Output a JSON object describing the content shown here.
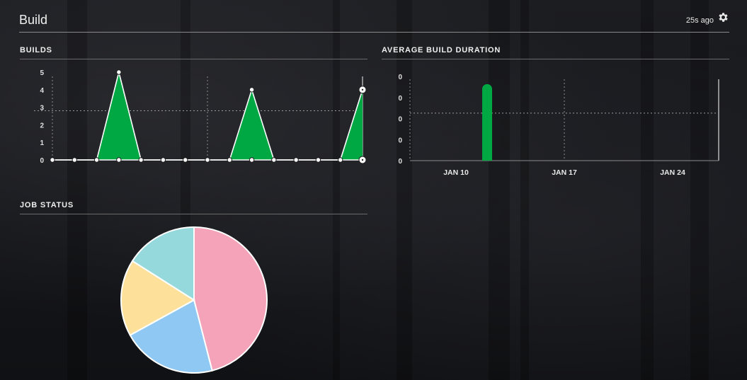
{
  "header": {
    "title": "Build",
    "updated": "25s ago"
  },
  "builds_panel": {
    "title": "BUILDS"
  },
  "duration_panel": {
    "title": "AVERAGE BUILD DURATION"
  },
  "job_status_panel": {
    "title": "JOB STATUS"
  },
  "colors": {
    "success_green": "#00a844",
    "pink": "#f4a3b8",
    "blue": "#8fc8f2",
    "yellow": "#fde09a",
    "teal": "#95d9dc"
  },
  "chart_data": [
    {
      "type": "area",
      "title": "BUILDS",
      "y_ticks": [
        "0",
        "1",
        "2",
        "3",
        "4",
        "5"
      ],
      "ylim": [
        0,
        5
      ],
      "x_index": [
        0,
        1,
        2,
        3,
        4,
        5,
        6,
        7,
        8,
        9,
        10,
        11,
        12,
        13,
        14
      ],
      "values": [
        0,
        0,
        0,
        5,
        0,
        0,
        0,
        0,
        0,
        4,
        0,
        0,
        0,
        0,
        4
      ],
      "reference_line": 2.8,
      "grid": "dotted"
    },
    {
      "type": "bar",
      "title": "AVERAGE BUILD DURATION",
      "y_ticks": [
        "0",
        "0",
        "0",
        "0",
        "0"
      ],
      "x_ticks": [
        "JAN 10",
        "JAN 17",
        "JAN 24"
      ],
      "bars": [
        {
          "date": "JAN 10",
          "value": 1
        }
      ],
      "ylim": [
        0,
        1.1
      ],
      "reference_line": 0.62,
      "grid": "dotted"
    },
    {
      "type": "pie",
      "title": "JOB STATUS",
      "slices": [
        {
          "color": "pink",
          "value": 46
        },
        {
          "color": "blue",
          "value": 21
        },
        {
          "color": "yellow",
          "value": 17
        },
        {
          "color": "teal",
          "value": 16
        }
      ]
    }
  ]
}
